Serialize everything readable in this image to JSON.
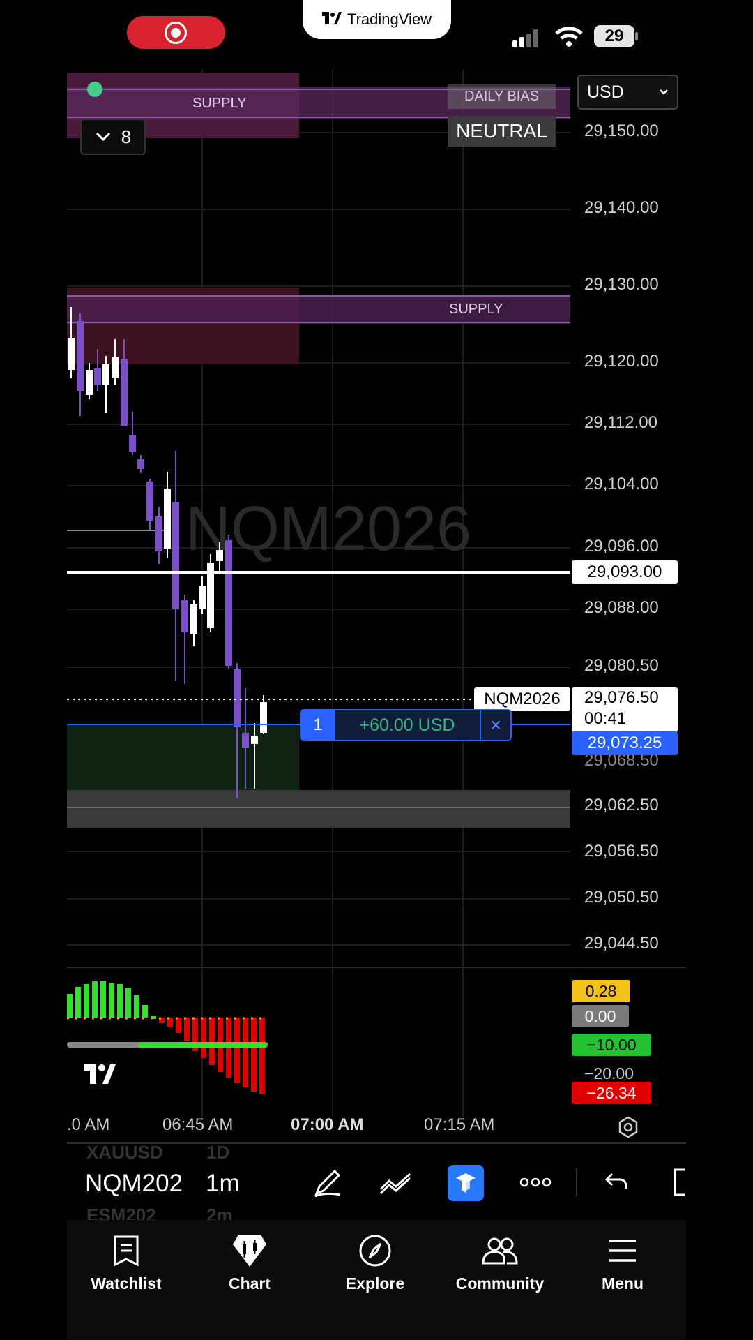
{
  "status_bar": {
    "app_pill": "TradingView",
    "battery": "29"
  },
  "chart": {
    "currency": "USD",
    "indicator_count": "8",
    "watermark": "NQM2026",
    "zones": {
      "supply_top": "SUPPLY",
      "supply_mid": "SUPPLY"
    },
    "daily_bias": {
      "label": "DAILY BIAS",
      "value": "NEUTRAL"
    },
    "price_axis": [
      "29,150.00",
      "29,140.00",
      "29,130.00",
      "29,120.00",
      "29,112.00",
      "29,104.00",
      "29,096.00",
      "29,088.00",
      "29,080.50",
      "29,062.50",
      "29,056.50",
      "29,050.50",
      "29,044.50"
    ],
    "hidden_label": "29,068.50",
    "line_price": "29,093.00",
    "symbol_tag": "NQM2026",
    "last_price": "29,076.50",
    "countdown": "00:41",
    "position_price": "29,073.25",
    "position": {
      "qty": "1",
      "pnl": "+60.00 USD",
      "close": "×"
    },
    "time_axis": [
      ".0 AM",
      "06:45 AM",
      "07:00 AM",
      "07:15 AM"
    ],
    "oscillator_labels": {
      "yellow": "0.28",
      "gray": "0.00",
      "green": "−10.00",
      "plain": "−20.00",
      "red": "−26.34"
    },
    "colors": {
      "bull_candle": "#ffffff",
      "bear_candle": "#7b4fc9",
      "supply_zone": "#5a1f44",
      "position_blue": "#2962ff",
      "osc_green": "#32e12e",
      "osc_red": "#e00000"
    }
  },
  "toolbar": {
    "symbols_faded_top": [
      "XAUUSD",
      "1D"
    ],
    "symbol": "NQM202",
    "interval": "1m",
    "symbols_faded_bottom": [
      "ESM202",
      "2m"
    ]
  },
  "bottom_nav": [
    {
      "label": "Watchlist",
      "icon": "watchlist-icon"
    },
    {
      "label": "Chart",
      "icon": "chart-icon"
    },
    {
      "label": "Explore",
      "icon": "compass-icon"
    },
    {
      "label": "Community",
      "icon": "community-icon"
    },
    {
      "label": "Menu",
      "icon": "menu-icon"
    }
  ]
}
